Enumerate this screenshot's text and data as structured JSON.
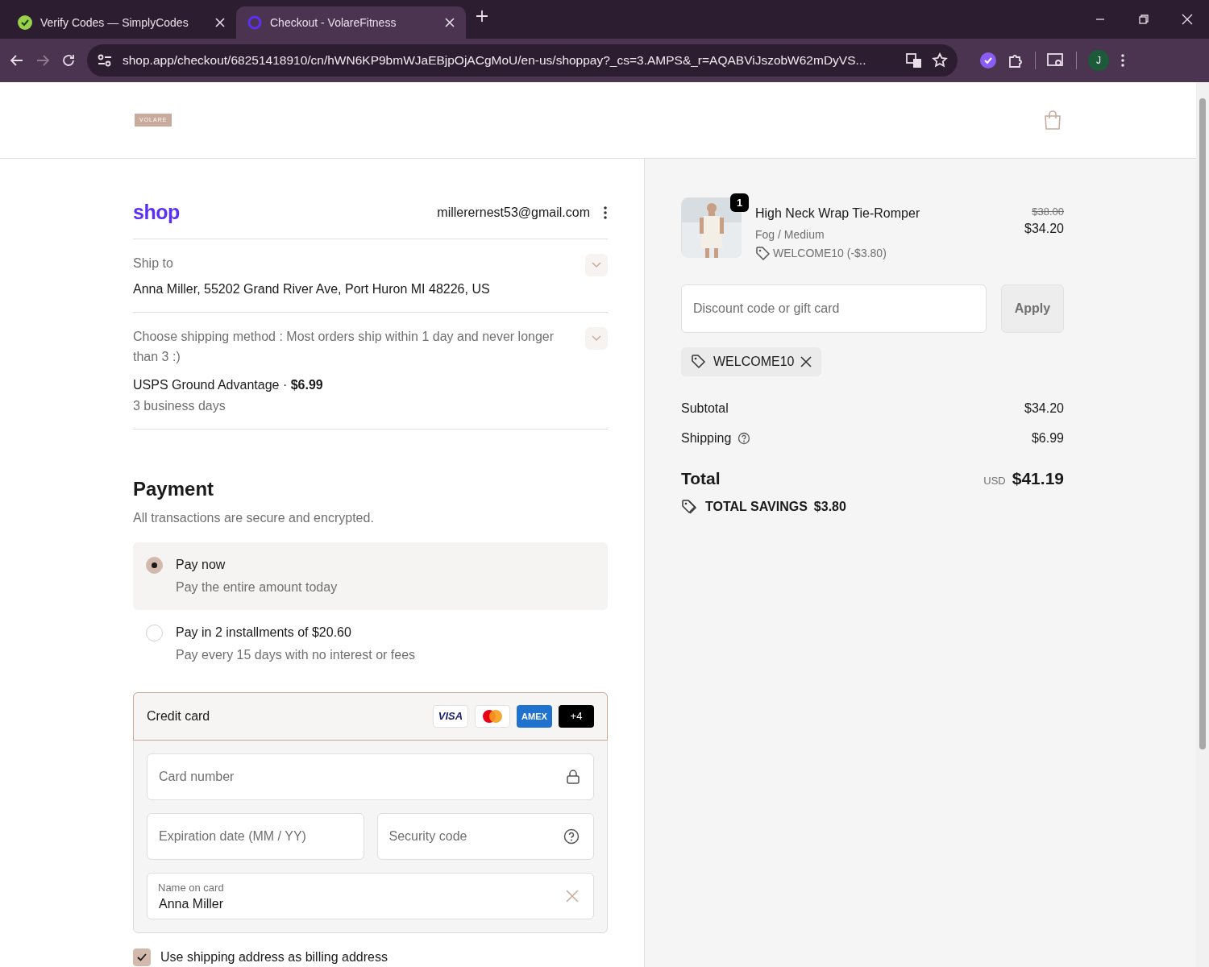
{
  "browser": {
    "tabs": [
      {
        "title": "Verify Codes — SimplyCodes",
        "selected": false
      },
      {
        "title": "Checkout - VolareFitness",
        "selected": true
      }
    ],
    "url": "shop.app/checkout/68251418910/cn/hWN6KP9bmWJaEBjpOjACgMoU/en-us/shoppay?_cs=3.AMPS&_r=AQABViJszobW62mDyVS...",
    "profile": "J"
  },
  "store": {
    "logo": "VOLARE"
  },
  "account": {
    "logo": "shop",
    "email": "millerernest53@gmail.com"
  },
  "ship_to": {
    "label": "Ship to",
    "address": "Anna Miller, 55202 Grand River Ave, Port Huron MI 48226, US"
  },
  "shipping": {
    "label": "Choose shipping method : Most orders ship within 1 day and never longer than 3 :)",
    "method": "USPS Ground Advantage · **$6.99**",
    "eta": "3 business days"
  },
  "payment": {
    "title": "Payment",
    "subtitle": "All transactions are secure and encrypted.",
    "options": [
      {
        "title": "Pay now",
        "subtitle": "Pay the entire amount today",
        "selected": true
      },
      {
        "title": "Pay in 2 installments of $20.60",
        "subtitle": "Pay every 15 days with no interest or fees",
        "selected": false
      }
    ]
  },
  "credit_card": {
    "label": "Credit card",
    "brands": [
      {
        "kind": "visa",
        "label": "VISA"
      },
      {
        "kind": "mastercard"
      },
      {
        "kind": "amex",
        "label": "AMEX"
      },
      {
        "kind": "more",
        "label": "+4"
      }
    ],
    "card_number": {
      "placeholder": "Card number"
    },
    "expiration": {
      "placeholder": "Expiration date (MM / YY)"
    },
    "security_code": {
      "placeholder": "Security code"
    },
    "name_on_card": {
      "label": "Name on card",
      "value": "Anna Miller"
    }
  },
  "billing": {
    "label": "Use shipping address as billing address",
    "checked": true
  },
  "summary": {
    "item": {
      "quantity": "1",
      "name": "High Neck Wrap Tie-Romper",
      "variant": "Fog / Medium",
      "discount": "WELCOME10 (-$3.80)",
      "original_price": "$38.00",
      "price": "$34.20"
    },
    "discount_field": {
      "placeholder": "Discount code or gift card"
    },
    "apply": "Apply",
    "applied_code": "WELCOME10",
    "lines": [
      {
        "label": "Subtotal",
        "value": "$34.20",
        "help": false
      },
      {
        "label": "Shipping",
        "value": "$6.99",
        "help": true
      }
    ],
    "total": {
      "label": "Total",
      "currency": "USD",
      "value": "$41.19"
    },
    "savings": {
      "label": "TOTAL SAVINGS",
      "value": "$3.80"
    }
  }
}
